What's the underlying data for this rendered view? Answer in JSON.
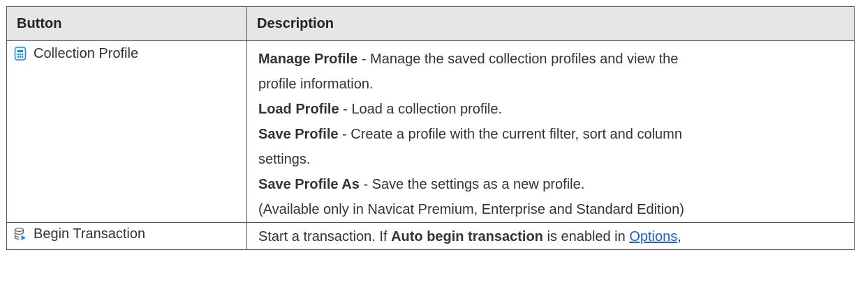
{
  "table": {
    "headers": [
      "Button",
      "Description"
    ],
    "rows": [
      {
        "button": {
          "icon": "collection-profile-icon",
          "label": "Collection Profile"
        },
        "lines": [
          {
            "bold": "Manage Profile",
            "text": " - Manage the saved collection profiles and view the"
          },
          {
            "bold": "",
            "text": "profile information."
          },
          {
            "bold": "Load Profile",
            "text": " - Load a collection profile."
          },
          {
            "bold": "Save Profile",
            "text": " - Create a profile with the current filter, sort and column"
          },
          {
            "bold": "",
            "text": "settings."
          },
          {
            "bold": "Save Profile As",
            "text": " - Save the settings as a new profile."
          },
          {
            "bold": "",
            "text": "(Available only in Navicat Premium, Enterprise and Standard Edition)"
          }
        ]
      },
      {
        "button": {
          "icon": "begin-transaction-icon",
          "label": "Begin Transaction"
        },
        "desc": {
          "pre": "Start a transaction. If ",
          "bold": "Auto begin transaction",
          "mid": " is enabled in ",
          "link": "Options",
          "post": ","
        }
      }
    ]
  },
  "colors": {
    "header_bg": "#e6e6e6",
    "border": "#555555",
    "link": "#1a5fd6",
    "icon_blue": "#1e88e5"
  }
}
